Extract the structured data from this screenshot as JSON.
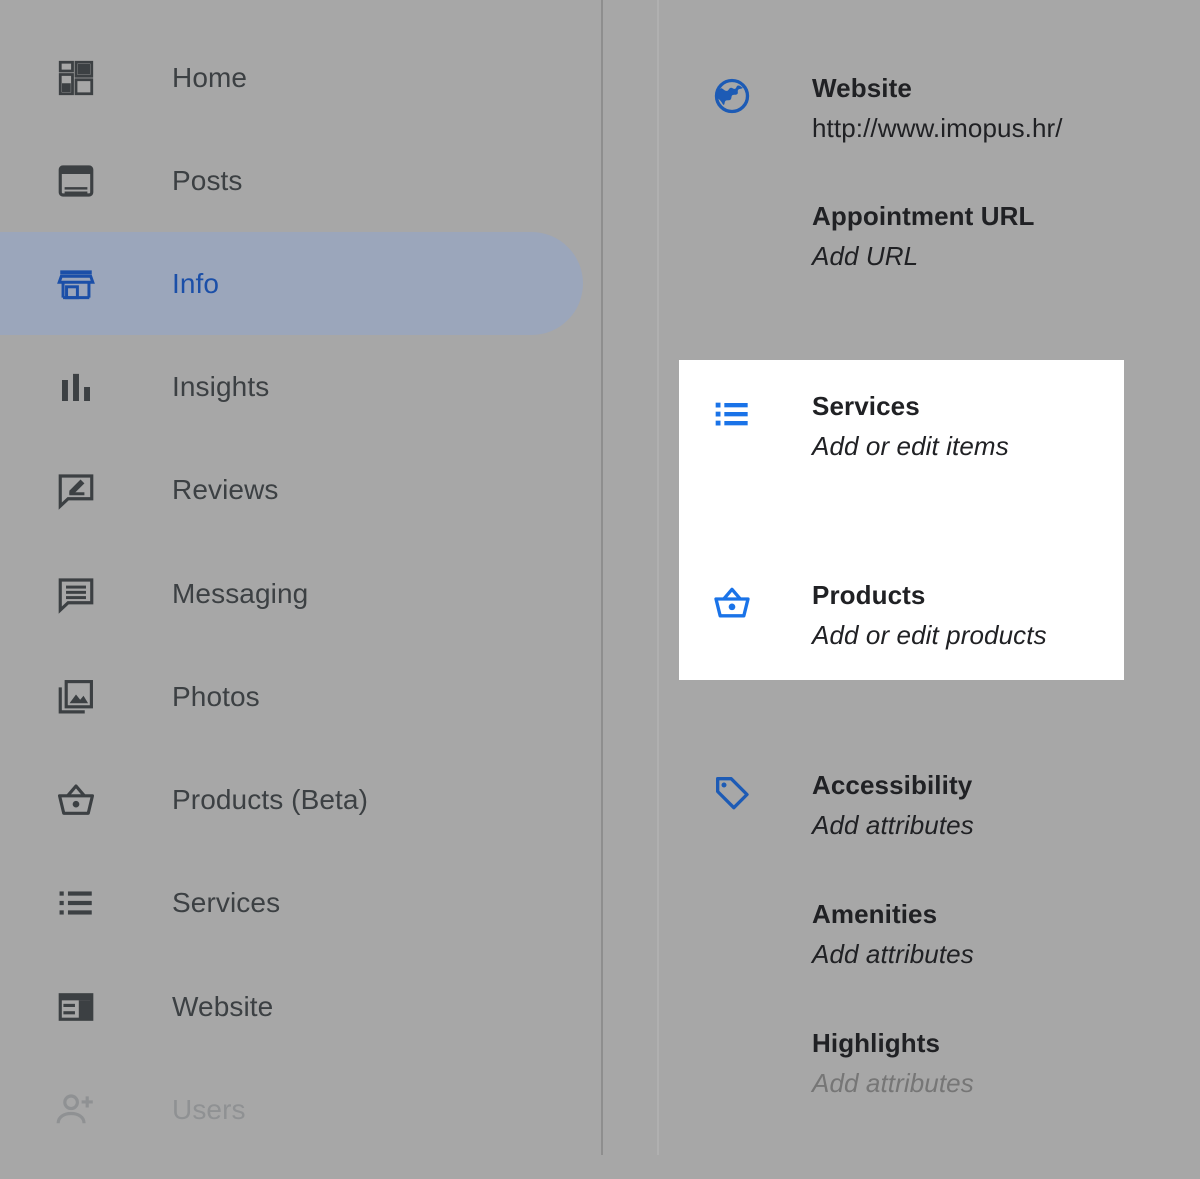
{
  "theme": {
    "overlay_grey": "#a7a7a7",
    "card_white": "#ffffff",
    "accent_blue": "#1a73e8",
    "active_pill": "#9ba6bb",
    "active_text": "#1b4fa8",
    "text_primary": "#202124",
    "text_muted": "#8f9193"
  },
  "sidebar": {
    "items": [
      {
        "label": "Home",
        "icon": "dashboard-icon",
        "state": "normal"
      },
      {
        "label": "Posts",
        "icon": "post-icon",
        "state": "normal"
      },
      {
        "label": "Info",
        "icon": "storefront-icon",
        "state": "active"
      },
      {
        "label": "Insights",
        "icon": "bar-chart-icon",
        "state": "normal"
      },
      {
        "label": "Reviews",
        "icon": "rate-review-icon",
        "state": "normal"
      },
      {
        "label": "Messaging",
        "icon": "message-icon",
        "state": "normal"
      },
      {
        "label": "Photos",
        "icon": "photo-library-icon",
        "state": "normal"
      },
      {
        "label": "Products (Beta)",
        "icon": "basket-icon",
        "state": "normal"
      },
      {
        "label": "Services",
        "icon": "list-icon",
        "state": "normal"
      },
      {
        "label": "Website",
        "icon": "web-layout-icon",
        "state": "normal"
      },
      {
        "label": "Users",
        "icon": "person-add-icon",
        "state": "dim"
      }
    ]
  },
  "info": {
    "rows": [
      {
        "title": "Website",
        "sub": "http://www.imopus.hr/",
        "sub_style": "plain",
        "icon": "globe-icon",
        "icon_color": "#1d5bb5"
      },
      {
        "title": "Appointment URL",
        "sub": "Add URL",
        "sub_style": "italic",
        "icon": null,
        "icon_color": null
      },
      {
        "title": "Services",
        "sub": "Add or edit items",
        "sub_style": "italic",
        "icon": "list-icon",
        "icon_color": "#1a73e8"
      },
      {
        "title": "Products",
        "sub": "Add or edit products",
        "sub_style": "italic",
        "icon": "basket-icon",
        "icon_color": "#1a73e8"
      },
      {
        "title": "Accessibility",
        "sub": "Add attributes",
        "sub_style": "italic",
        "icon": "tag-icon",
        "icon_color": "#1d5bb5"
      },
      {
        "title": "Amenities",
        "sub": "Add attributes",
        "sub_style": "italic",
        "icon": null,
        "icon_color": null
      },
      {
        "title": "Highlights",
        "sub": "Add attributes",
        "sub_style": "italic-muted",
        "icon": null,
        "icon_color": null
      }
    ]
  },
  "spotlight": {
    "highlighted_rows": [
      "Services",
      "Products"
    ]
  }
}
